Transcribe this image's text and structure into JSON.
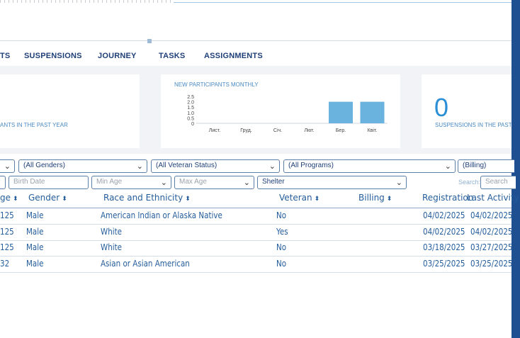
{
  "tabs": [
    "TS",
    "SUSPENSIONS",
    "JOURNEY",
    "TASKS",
    "ASSIGNMENTS"
  ],
  "card1": {
    "caption": "ANTS IN THE PAST YEAR"
  },
  "card2": {
    "title": "NEW PARTICIPANTS MONTHLY"
  },
  "card3": {
    "value": "0",
    "caption": "SUSPENSIONS IN THE PAST"
  },
  "chart_data": {
    "type": "bar",
    "title": "NEW PARTICIPANTS MONTHLY",
    "categories": [
      "Лист.",
      "Груд.",
      "Січ.",
      "Лют.",
      "Бер.",
      "Квіт."
    ],
    "values": [
      0,
      0,
      0,
      0,
      2,
      2
    ],
    "yticks": [
      "2.5",
      "2.0",
      "1.5",
      "1.0",
      "0.5",
      "0"
    ],
    "ylim": [
      0,
      2.5
    ],
    "grid": false,
    "color": "#6ab3df"
  },
  "filters": {
    "genders": "(All Genders)",
    "veteran": "(All Veteran Status)",
    "programs": "(All Programs)",
    "billing": "(Billing)",
    "birth_date_ph": "Birth Date",
    "min_age_ph": "Min Age",
    "max_age_ph": "Max Age",
    "program_value": "Shelter",
    "search_label": "Search:",
    "search_ph": "Search"
  },
  "table": {
    "headers": {
      "age": "ge",
      "gender": "Gender",
      "race": "Race and Ethnicity",
      "veteran": "Veteran",
      "billing": "Billing",
      "registration": "Registration",
      "last_activity": "Last Activity"
    },
    "rows": [
      {
        "age": "125",
        "gender": "Male",
        "race": "American Indian or Alaska Native",
        "veteran": "No",
        "registration": "04/02/2025",
        "last_activity": "04/02/2025"
      },
      {
        "age": "125",
        "gender": "Male",
        "race": "White",
        "veteran": "Yes",
        "registration": "04/02/2025",
        "last_activity": "04/02/2025"
      },
      {
        "age": "125",
        "gender": "Male",
        "race": "White",
        "veteran": "No",
        "registration": "03/18/2025",
        "last_activity": "03/27/2025"
      },
      {
        "age": "32",
        "gender": "Male",
        "race": "Asian or Asian American",
        "veteran": "No",
        "registration": "03/25/2025",
        "last_activity": "03/25/2025"
      }
    ]
  }
}
